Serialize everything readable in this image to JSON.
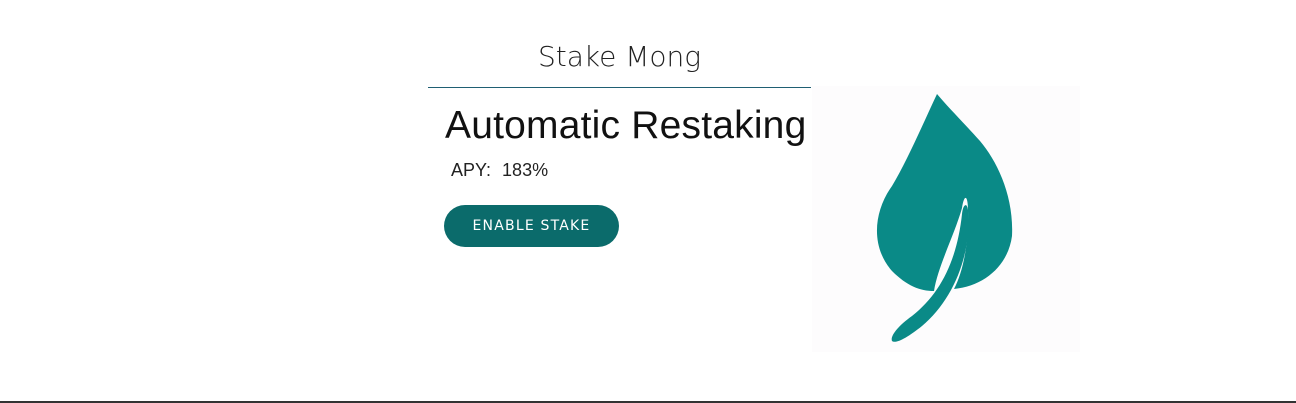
{
  "app": {
    "title": "Stake Mong"
  },
  "stake": {
    "heading": "Automatic Restaking",
    "apy_label": "APY:",
    "apy_value": "183%",
    "button_label": "ENABLE STAKE"
  },
  "icons": {
    "illustration": "leaf-icon"
  },
  "colors": {
    "accent": "#0b6b6b",
    "leaf": "#0a8a87",
    "rule": "#1f5f73"
  }
}
